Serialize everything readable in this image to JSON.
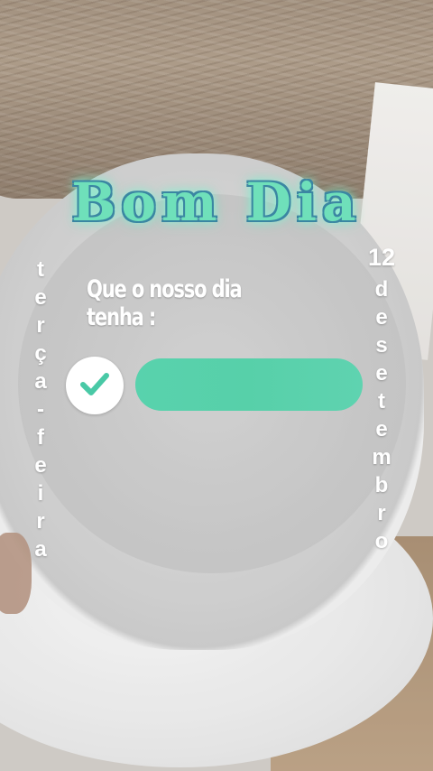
{
  "title": "Bom Dia",
  "question": "Que o nosso dia tenha :",
  "option": {
    "checked": true,
    "text": ""
  },
  "weekday_letters": [
    "t",
    "e",
    "r",
    "ç",
    "a",
    "-",
    "f",
    "e",
    "i",
    "r",
    "a"
  ],
  "date": {
    "day": "12",
    "month_letters": [
      "d",
      "e",
      "s",
      "e",
      "t",
      "e",
      "m",
      "b",
      "r",
      "o"
    ]
  },
  "colors": {
    "title_fill": "#6fe0ba",
    "title_outline": "#3b86a2",
    "pill": "#58d2ad",
    "check": "#49c9a6"
  },
  "icons": {
    "check": "check-icon"
  }
}
